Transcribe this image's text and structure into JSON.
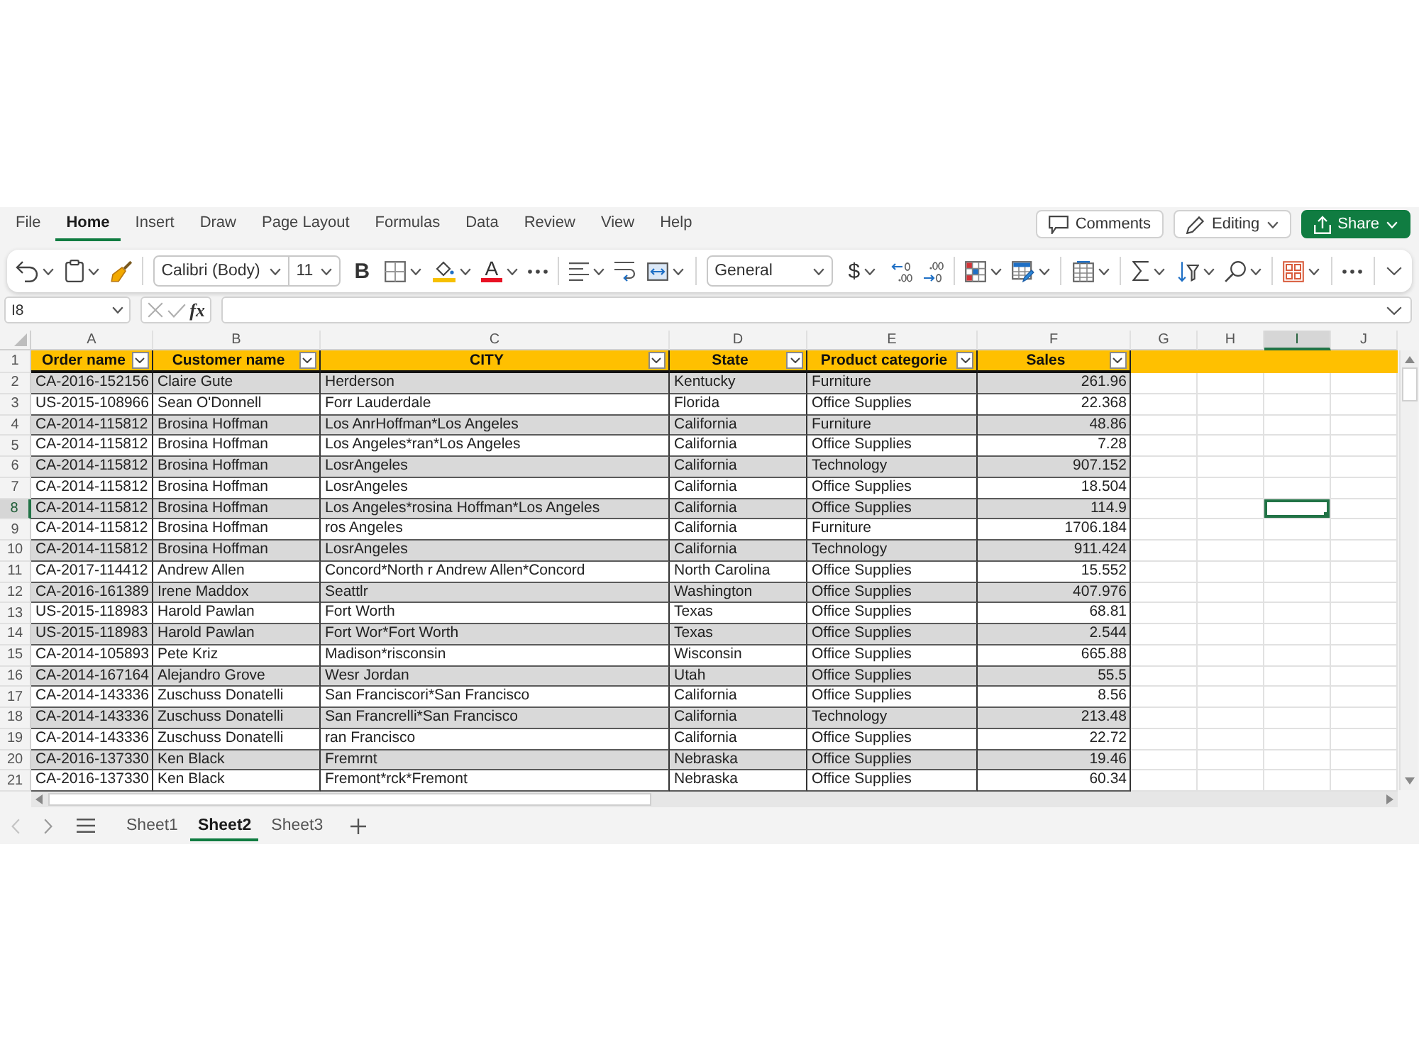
{
  "ribbon_tabs": [
    {
      "label": "File",
      "selected": false
    },
    {
      "label": "Home",
      "selected": true
    },
    {
      "label": "Insert",
      "selected": false
    },
    {
      "label": "Draw",
      "selected": false
    },
    {
      "label": "Page Layout",
      "selected": false
    },
    {
      "label": "Formulas",
      "selected": false
    },
    {
      "label": "Data",
      "selected": false
    },
    {
      "label": "Review",
      "selected": false
    },
    {
      "label": "View",
      "selected": false
    },
    {
      "label": "Help",
      "selected": false
    }
  ],
  "actions": {
    "comments": "Comments",
    "editing": "Editing",
    "share": "Share"
  },
  "toolbar": {
    "font_family": "Calibri (Body)",
    "font_size": "11",
    "bold_label": "B",
    "font_color_label": "A",
    "number_format": "General",
    "currency_label": "$"
  },
  "formula_bar": {
    "name_box": "I8",
    "function_label": "fx"
  },
  "sheet": {
    "banded": true,
    "columns": [
      {
        "letter": "A",
        "selected": false
      },
      {
        "letter": "B",
        "selected": false
      },
      {
        "letter": "C",
        "selected": false
      },
      {
        "letter": "D",
        "selected": false
      },
      {
        "letter": "E",
        "selected": false
      },
      {
        "letter": "F",
        "selected": false
      },
      {
        "letter": "G",
        "selected": false
      },
      {
        "letter": "H",
        "selected": false
      },
      {
        "letter": "I",
        "selected": true
      },
      {
        "letter": "J",
        "selected": false
      }
    ],
    "header_row": {
      "number": "1",
      "selected": false,
      "cells": [
        {
          "text": "Order name",
          "filter": true
        },
        {
          "text": "Customer name",
          "filter": true
        },
        {
          "text": "CITY",
          "filter": true
        },
        {
          "text": "State",
          "filter": true
        },
        {
          "text": "Product categorie",
          "filter": true
        },
        {
          "text": "Sales",
          "filter": true
        }
      ]
    },
    "rows": [
      {
        "number": "2",
        "selected": false,
        "cells": [
          "CA-2016-152156",
          "Claire Gute",
          "Herderson",
          "Kentucky",
          "Furniture",
          "261.96"
        ]
      },
      {
        "number": "3",
        "selected": false,
        "cells": [
          "US-2015-108966",
          "Sean O'Donnell",
          "Forr Lauderdale",
          "Florida",
          "Office Supplies",
          "22.368"
        ]
      },
      {
        "number": "4",
        "selected": false,
        "cells": [
          "CA-2014-115812",
          "Brosina Hoffman",
          "Los AnrHoffman*Los Angeles",
          "California",
          "Furniture",
          "48.86"
        ]
      },
      {
        "number": "5",
        "selected": false,
        "cells": [
          "CA-2014-115812",
          "Brosina Hoffman",
          "Los Angeles*ran*Los Angeles",
          "California",
          "Office Supplies",
          "7.28"
        ]
      },
      {
        "number": "6",
        "selected": false,
        "cells": [
          "CA-2014-115812",
          "Brosina Hoffman",
          "LosrAngeles",
          "California",
          "Technology",
          "907.152"
        ]
      },
      {
        "number": "7",
        "selected": false,
        "cells": [
          "CA-2014-115812",
          "Brosina Hoffman",
          "LosrAngeles",
          "California",
          "Office Supplies",
          "18.504"
        ]
      },
      {
        "number": "8",
        "selected": true,
        "cells": [
          "CA-2014-115812",
          "Brosina Hoffman",
          "Los Angeles*rosina Hoffman*Los Angeles",
          "California",
          "Office Supplies",
          "114.9"
        ]
      },
      {
        "number": "9",
        "selected": false,
        "cells": [
          "CA-2014-115812",
          "Brosina Hoffman",
          "ros Angeles",
          "California",
          "Furniture",
          "1706.184"
        ]
      },
      {
        "number": "10",
        "selected": false,
        "cells": [
          "CA-2014-115812",
          "Brosina Hoffman",
          "LosrAngeles",
          "California",
          "Technology",
          "911.424"
        ]
      },
      {
        "number": "11",
        "selected": false,
        "cells": [
          "CA-2017-114412",
          "Andrew Allen",
          "Concord*North r Andrew Allen*Concord",
          "North Carolina",
          "Office Supplies",
          "15.552"
        ]
      },
      {
        "number": "12",
        "selected": false,
        "cells": [
          "CA-2016-161389",
          "Irene Maddox",
          "Seattlr",
          "Washington",
          "Office Supplies",
          "407.976"
        ]
      },
      {
        "number": "13",
        "selected": false,
        "cells": [
          "US-2015-118983",
          "Harold Pawlan",
          "Fort Worth",
          "Texas",
          "Office Supplies",
          "68.81"
        ]
      },
      {
        "number": "14",
        "selected": false,
        "cells": [
          "US-2015-118983",
          "Harold Pawlan",
          "Fort Wor*Fort Worth",
          "Texas",
          "Office Supplies",
          "2.544"
        ]
      },
      {
        "number": "15",
        "selected": false,
        "cells": [
          "CA-2014-105893",
          "Pete Kriz",
          "Madison*risconsin",
          "Wisconsin",
          "Office Supplies",
          "665.88"
        ]
      },
      {
        "number": "16",
        "selected": false,
        "cells": [
          "CA-2014-167164",
          "Alejandro Grove",
          "Wesr Jordan",
          "Utah",
          "Office Supplies",
          "55.5"
        ]
      },
      {
        "number": "17",
        "selected": false,
        "cells": [
          "CA-2014-143336",
          "Zuschuss Donatelli",
          "San Franciscori*San Francisco",
          "California",
          "Office Supplies",
          "8.56"
        ]
      },
      {
        "number": "18",
        "selected": false,
        "cells": [
          "CA-2014-143336",
          "Zuschuss Donatelli",
          "San Francrelli*San Francisco",
          "California",
          "Technology",
          "213.48"
        ]
      },
      {
        "number": "19",
        "selected": false,
        "cells": [
          "CA-2014-143336",
          "Zuschuss Donatelli",
          "ran Francisco",
          "California",
          "Office Supplies",
          "22.72"
        ]
      },
      {
        "number": "20",
        "selected": false,
        "cells": [
          "CA-2016-137330",
          "Ken Black",
          "Fremrnt",
          "Nebraska",
          "Office Supplies",
          "19.46"
        ]
      },
      {
        "number": "21",
        "selected": false,
        "cells": [
          "CA-2016-137330",
          "Ken Black",
          "Fremont*rck*Fremont",
          "Nebraska",
          "Office Supplies",
          "60.34"
        ]
      }
    ]
  },
  "sheet_tabs": [
    {
      "label": "Sheet1",
      "selected": false
    },
    {
      "label": "Sheet2",
      "selected": true
    },
    {
      "label": "Sheet3",
      "selected": false
    }
  ]
}
